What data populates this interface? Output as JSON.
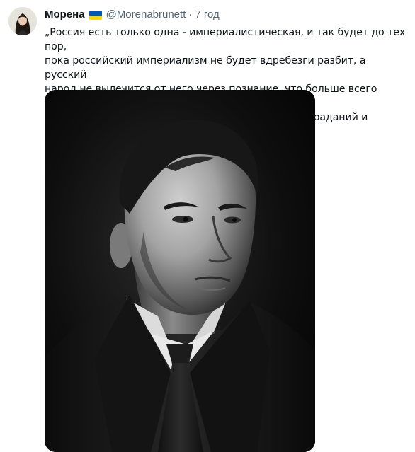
{
  "author": {
    "display_name": "Морена",
    "flag_icon": "ukraine-flag-icon",
    "flag_colors": [
      "#0057b7",
      "#ffd700"
    ],
    "handle": "@Morenabrunett",
    "separator": "·",
    "time": "7 год"
  },
  "tweet": {
    "text": "„Россия есть только одна - империалистическая, и так будет до тех пор,\nпока российский империализм не будет вдребезги разбит, а русский\nнарод не вылечится от него через познание, что больше всего бедствий\nего империализм приносит ему самому - жертв, страданий и падений.“"
  },
  "media": {
    "type": "photo",
    "description_icon": "black-and-white-portrait-photo"
  },
  "colors": {
    "text_primary": "#0f1419",
    "text_secondary": "#536471",
    "background": "#ffffff"
  }
}
